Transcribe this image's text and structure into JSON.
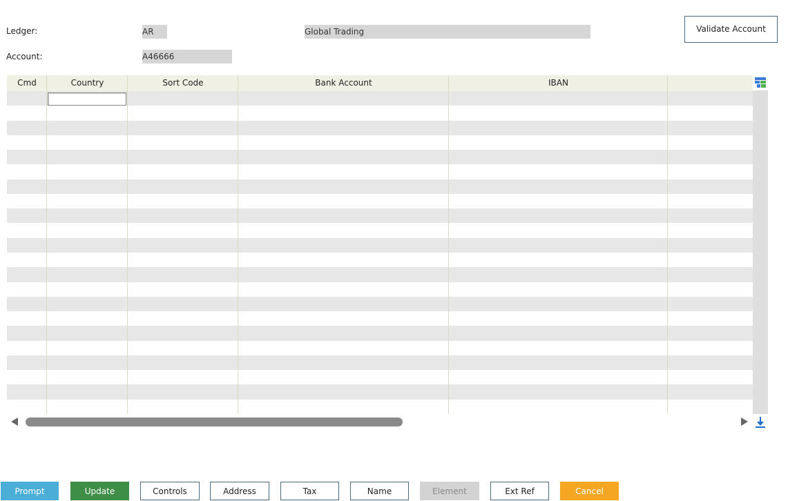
{
  "form": {
    "ledger_label": "Ledger:",
    "ledger_value": "AR",
    "ledger_name": "Global Trading",
    "account_label": "Account:",
    "account_value": "A46666",
    "validate_label": "Validate Account"
  },
  "grid": {
    "columns": [
      "Cmd",
      "Country",
      "Sort Code",
      "Bank Account",
      "IBAN",
      ""
    ],
    "rows": [],
    "row_count": 22
  },
  "icons": {
    "grid_options": "grid-options-icon",
    "download": "download-icon",
    "scroll_left": "scroll-left-arrow-icon",
    "scroll_right": "scroll-right-arrow-icon"
  },
  "buttons": [
    {
      "label": "Prompt",
      "style": "info",
      "color": "#4aaed6"
    },
    {
      "label": "Update",
      "style": "success",
      "color": "#3e8e47"
    },
    {
      "label": "Controls",
      "style": "default"
    },
    {
      "label": "Address",
      "style": "default"
    },
    {
      "label": "Tax",
      "style": "default"
    },
    {
      "label": "Name",
      "style": "default"
    },
    {
      "label": "Element",
      "style": "disabled",
      "color": "#d3d3d3"
    },
    {
      "label": "Ext Ref",
      "style": "default"
    },
    {
      "label": "Cancel",
      "style": "warning",
      "color": "#f5a623"
    }
  ]
}
